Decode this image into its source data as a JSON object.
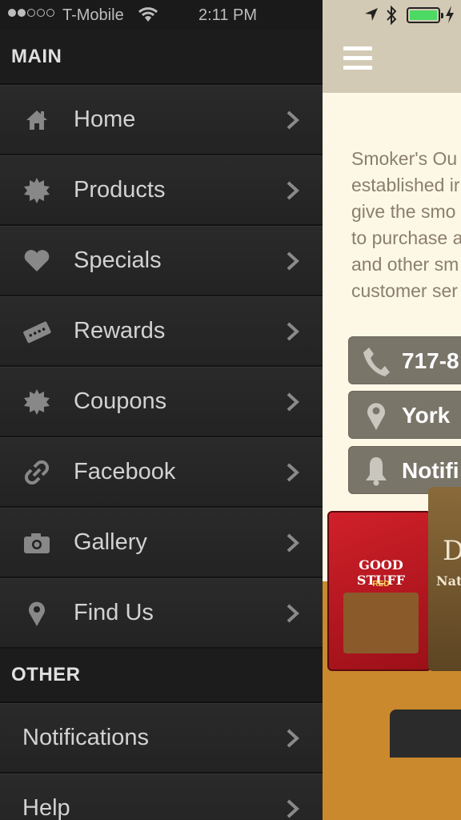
{
  "status_bar": {
    "carrier": "T-Mobile",
    "time": "2:11 PM",
    "battery_color": "#4cd964"
  },
  "menu": {
    "sections": [
      {
        "title": "MAIN",
        "items": [
          {
            "label": "Home",
            "icon": "home-icon"
          },
          {
            "label": "Products",
            "icon": "badge-icon"
          },
          {
            "label": "Specials",
            "icon": "heart-icon"
          },
          {
            "label": "Rewards",
            "icon": "ticket-icon"
          },
          {
            "label": "Coupons",
            "icon": "badge-icon"
          },
          {
            "label": "Facebook",
            "icon": "link-icon"
          },
          {
            "label": "Gallery",
            "icon": "camera-icon"
          },
          {
            "label": "Find Us",
            "icon": "map-pin-icon"
          }
        ]
      },
      {
        "title": "OTHER",
        "items": [
          {
            "label": "Notifications"
          },
          {
            "label": "Help"
          }
        ]
      }
    ]
  },
  "content": {
    "about_lines": [
      "Smoker's Ou",
      "established ir",
      "give the smo",
      "to purchase a",
      "and other sm",
      "customer ser"
    ],
    "buttons": [
      {
        "label": "717-8",
        "icon": "phone-icon"
      },
      {
        "label": "York",
        "icon": "map-pin-icon"
      },
      {
        "label": "Notifi",
        "icon": "bell-icon"
      }
    ],
    "product_image": {
      "brand": "GOOD STUFF",
      "variant": "RED",
      "second_bag_letter": "D",
      "second_bag_text": "Nat"
    }
  },
  "colors": {
    "menu_bg": "#222222",
    "content_bg": "#fdf8e6",
    "nav_bg": "#d3cab5",
    "button_bg": "#7a7569",
    "text_brown": "#8b7f6a"
  }
}
